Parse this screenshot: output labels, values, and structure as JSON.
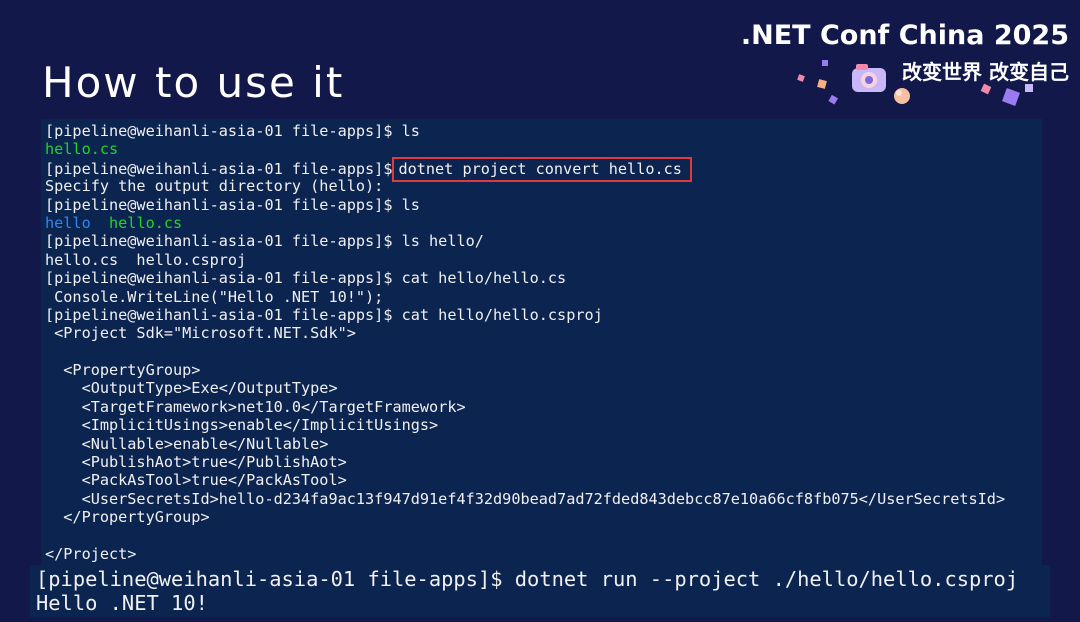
{
  "slide": {
    "title": "How to use it"
  },
  "brand": {
    "title": ".NET Conf China 2025",
    "subtitle": "改变世界 改变自己",
    "logo_icon": "camera-mascot-icon",
    "colors": {
      "pink": "#f08aa8",
      "purple": "#9b7bf0",
      "orange": "#f5b080"
    }
  },
  "terminal": {
    "colors": {
      "background": "#0c2450",
      "text": "#f0f0f0",
      "green": "#22d22a",
      "blue": "#2f86f0",
      "highlight_border": "#e0393e"
    },
    "lines": [
      "[pipeline@weihanli-asia-01 file-apps]$ ls",
      "hello.cs",
      "[pipeline@weihanli-asia-01 file-apps]$",
      "dotnet project convert hello.cs",
      "Specify the output directory (hello):",
      "[pipeline@weihanli-asia-01 file-apps]$ ls",
      "hello",
      "hello.cs",
      "[pipeline@weihanli-asia-01 file-apps]$ ls hello/",
      "hello.cs  hello.csproj",
      "[pipeline@weihanli-asia-01 file-apps]$ cat hello/hello.cs",
      " Console.WriteLine(\"Hello .NET 10!\");",
      "[pipeline@weihanli-asia-01 file-apps]$ cat hello/hello.csproj",
      " <Project Sdk=\"Microsoft.NET.Sdk\">",
      "",
      "  <PropertyGroup>",
      "    <OutputType>Exe</OutputType>",
      "    <TargetFramework>net10.0</TargetFramework>",
      "    <ImplicitUsings>enable</ImplicitUsings>",
      "    <Nullable>enable</Nullable>",
      "    <PublishAot>true</PublishAot>",
      "    <PackAsTool>true</PackAsTool>",
      "    <UserSecretsId>hello-d234fa9ac13f947d91ef4f32d90bead7ad72fded843debcc87e10a66cf8fb075</UserSecretsId>",
      "  </PropertyGroup>",
      "",
      "</Project>"
    ]
  },
  "run_panel": {
    "command": "[pipeline@weihanli-asia-01 file-apps]$ dotnet run --project ./hello/hello.csproj",
    "output": "Hello .NET 10!"
  }
}
